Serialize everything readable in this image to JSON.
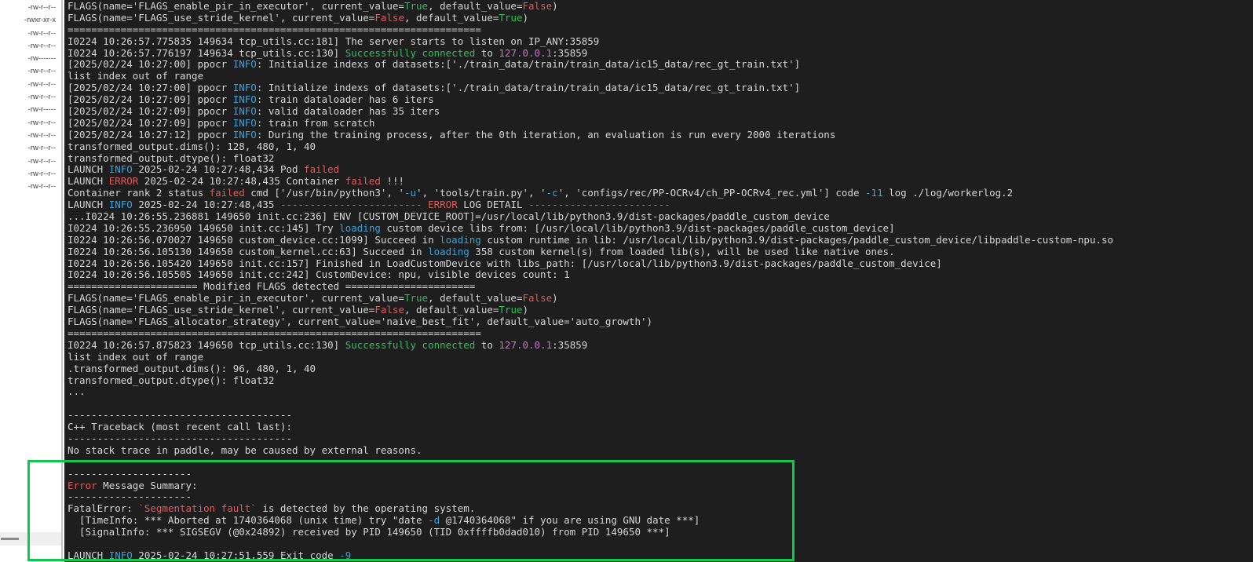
{
  "colors": {
    "terminal_bg": "#1e1e1e",
    "default": "#d6d6d6",
    "cyan": "#3ca1d8",
    "green": "#2cc05c",
    "red": "#df5b5b",
    "magenta": "#cf6ecf",
    "highlight_box": "#12c74e",
    "sidebar_bg": "#ffffff",
    "sidebar_text": "#3f3f3f"
  },
  "sidebar": {
    "permissions": [
      "-rw-r--r--",
      "-rwxr-xr-x",
      "-rw-r--r--",
      "-rw-r--r--",
      "-rw-------",
      "-rw-r--r--",
      "-rw-r--r--",
      "-rw-r--r--",
      "-rw-r-----",
      "-rw-r--r--",
      "-rw-r--r--",
      "-rw-r--r--",
      "-rw-r--r--",
      "-rw-r--r--",
      "-rw-r--r--"
    ]
  },
  "annotation": {
    "highlight_box_present": true
  },
  "terminal": {
    "lines": [
      {
        "segments": [
          {
            "text": "FLAGS(name='FLAGS_enable_pir_in_executor', current_value=",
            "color": "default"
          },
          {
            "text": "True",
            "color": "green"
          },
          {
            "text": ", default_value=",
            "color": "default"
          },
          {
            "text": "False",
            "color": "red"
          },
          {
            "text": ")",
            "color": "default"
          }
        ]
      },
      {
        "segments": [
          {
            "text": "FLAGS(name='FLAGS_use_stride_kernel', current_value=",
            "color": "default"
          },
          {
            "text": "False",
            "color": "red"
          },
          {
            "text": ", default_value=",
            "color": "default"
          },
          {
            "text": "True",
            "color": "green"
          },
          {
            "text": ")",
            "color": "default"
          }
        ]
      },
      {
        "segments": [
          {
            "text": "======================================================================",
            "color": "default"
          }
        ]
      },
      {
        "segments": [
          {
            "text": "I0224 10:26:57.775835 149634 tcp_utils.cc:181] The server starts to listen on IP_ANY:35859",
            "color": "default"
          }
        ]
      },
      {
        "segments": [
          {
            "text": "I0224 10:26:57.776197 149634 tcp_utils.cc:130] ",
            "color": "default"
          },
          {
            "text": "Successfully connected",
            "color": "green"
          },
          {
            "text": " to ",
            "color": "default"
          },
          {
            "text": "127.0.0.1",
            "color": "magenta"
          },
          {
            "text": ":35859",
            "color": "default"
          }
        ]
      },
      {
        "segments": [
          {
            "text": "[2025/02/24 10:27:00] ppocr ",
            "color": "default"
          },
          {
            "text": "INFO",
            "color": "cyan"
          },
          {
            "text": ": Initialize indexs of datasets:['./train_data/train/train_data/ic15_data/rec_gt_train.txt']",
            "color": "default"
          }
        ]
      },
      {
        "segments": [
          {
            "text": "list index out of range",
            "color": "default"
          }
        ]
      },
      {
        "segments": [
          {
            "text": "[2025/02/24 10:27:00] ppocr ",
            "color": "default"
          },
          {
            "text": "INFO",
            "color": "cyan"
          },
          {
            "text": ": Initialize indexs of datasets:['./train_data/train/train_data/ic15_data/rec_gt_train.txt']",
            "color": "default"
          }
        ]
      },
      {
        "segments": [
          {
            "text": "[2025/02/24 10:27:09] ppocr ",
            "color": "default"
          },
          {
            "text": "INFO",
            "color": "cyan"
          },
          {
            "text": ": train dataloader has 6 iters",
            "color": "default"
          }
        ]
      },
      {
        "segments": [
          {
            "text": "[2025/02/24 10:27:09] ppocr ",
            "color": "default"
          },
          {
            "text": "INFO",
            "color": "cyan"
          },
          {
            "text": ": valid dataloader has 35 iters",
            "color": "default"
          }
        ]
      },
      {
        "segments": [
          {
            "text": "[2025/02/24 10:27:09] ppocr ",
            "color": "default"
          },
          {
            "text": "INFO",
            "color": "cyan"
          },
          {
            "text": ": train from scratch",
            "color": "default"
          }
        ]
      },
      {
        "segments": [
          {
            "text": "[2025/02/24 10:27:12] ppocr ",
            "color": "default"
          },
          {
            "text": "INFO",
            "color": "cyan"
          },
          {
            "text": ": During the training process, after the 0th iteration, an evaluation is run every 2000 iterations",
            "color": "default"
          }
        ]
      },
      {
        "segments": [
          {
            "text": "transformed_output.dims(): 128, 480, 1, 40",
            "color": "default"
          }
        ]
      },
      {
        "segments": [
          {
            "text": "transformed_output.dtype(): float32",
            "color": "default"
          }
        ]
      },
      {
        "segments": [
          {
            "text": "LAUNCH ",
            "color": "default"
          },
          {
            "text": "INFO",
            "color": "cyan"
          },
          {
            "text": " 2025-02-24 10:27:48,434 Pod ",
            "color": "default"
          },
          {
            "text": "failed",
            "color": "red"
          }
        ]
      },
      {
        "segments": [
          {
            "text": "LAUNCH ",
            "color": "default"
          },
          {
            "text": "ERROR",
            "color": "red"
          },
          {
            "text": " 2025-02-24 10:27:48,435 Container ",
            "color": "default"
          },
          {
            "text": "failed",
            "color": "red"
          },
          {
            "text": " !!!",
            "color": "default"
          }
        ]
      },
      {
        "segments": [
          {
            "text": "Container rank 2 status ",
            "color": "default"
          },
          {
            "text": "failed",
            "color": "red"
          },
          {
            "text": " cmd ['/usr/bin/python3', '",
            "color": "default"
          },
          {
            "text": "-u",
            "color": "cyan"
          },
          {
            "text": "', 'tools/train.py', '",
            "color": "default"
          },
          {
            "text": "-c",
            "color": "cyan"
          },
          {
            "text": "', 'configs/rec/PP-OCRv4/ch_PP-OCRv4_rec.yml'] code ",
            "color": "default"
          },
          {
            "text": "-11",
            "color": "cyan"
          },
          {
            "text": " log ./log/workerlog.2",
            "color": "default"
          }
        ]
      },
      {
        "segments": [
          {
            "text": "LAUNCH ",
            "color": "default"
          },
          {
            "text": "INFO",
            "color": "cyan"
          },
          {
            "text": " 2025-02-24 10:27:48,435 ",
            "color": "default"
          },
          {
            "text": "------------------------ ",
            "color": "cyan"
          },
          {
            "text": "ERROR",
            "color": "red"
          },
          {
            "text": " LOG DETAIL ",
            "color": "default"
          },
          {
            "text": "------------------------",
            "color": "cyan"
          }
        ]
      },
      {
        "segments": [
          {
            "text": "...I0224 10:26:55.236881 149650 init.cc:236] ENV [CUSTOM_DEVICE_ROOT]=/usr/local/lib/python3.9/dist-packages/paddle_custom_device",
            "color": "default"
          }
        ]
      },
      {
        "segments": [
          {
            "text": "I0224 10:26:55.236950 149650 init.cc:145] Try ",
            "color": "default"
          },
          {
            "text": "loading",
            "color": "cyan"
          },
          {
            "text": " custom device libs from: [/usr/local/lib/python3.9/dist-packages/paddle_custom_device]",
            "color": "default"
          }
        ]
      },
      {
        "segments": [
          {
            "text": "I0224 10:26:56.070027 149650 custom_device.cc:1099] Succeed in ",
            "color": "default"
          },
          {
            "text": "loading",
            "color": "cyan"
          },
          {
            "text": " custom runtime in lib: /usr/local/lib/python3.9/dist-packages/paddle_custom_device/libpaddle-custom-npu.so",
            "color": "default"
          }
        ]
      },
      {
        "segments": [
          {
            "text": "I0224 10:26:56.105130 149650 custom_kernel.cc:63] Succeed in ",
            "color": "default"
          },
          {
            "text": "loading",
            "color": "cyan"
          },
          {
            "text": " 358 custom kernel(s) from loaded lib(s), will be used like native ones.",
            "color": "default"
          }
        ]
      },
      {
        "segments": [
          {
            "text": "I0224 10:26:56.105420 149650 init.cc:157] Finished in LoadCustomDevice with libs_path: [/usr/local/lib/python3.9/dist-packages/paddle_custom_device]",
            "color": "default"
          }
        ]
      },
      {
        "segments": [
          {
            "text": "I0224 10:26:56.105505 149650 init.cc:242] CustomDevice: npu, visible devices count: 1",
            "color": "default"
          }
        ]
      },
      {
        "segments": [
          {
            "text": "====================== Modified FLAGS detected ======================",
            "color": "default"
          }
        ]
      },
      {
        "segments": [
          {
            "text": "FLAGS(name='FLAGS_enable_pir_in_executor', current_value=",
            "color": "default"
          },
          {
            "text": "True",
            "color": "green"
          },
          {
            "text": ", default_value=",
            "color": "default"
          },
          {
            "text": "False",
            "color": "red"
          },
          {
            "text": ")",
            "color": "default"
          }
        ]
      },
      {
        "segments": [
          {
            "text": "FLAGS(name='FLAGS_use_stride_kernel', current_value=",
            "color": "default"
          },
          {
            "text": "False",
            "color": "red"
          },
          {
            "text": ", default_value=",
            "color": "default"
          },
          {
            "text": "True",
            "color": "green"
          },
          {
            "text": ")",
            "color": "default"
          }
        ]
      },
      {
        "segments": [
          {
            "text": "FLAGS(name='FLAGS_allocator_strategy', current_value='naive_best_fit', default_value='auto_growth')",
            "color": "default"
          }
        ]
      },
      {
        "segments": [
          {
            "text": "======================================================================",
            "color": "default"
          }
        ]
      },
      {
        "segments": [
          {
            "text": "I0224 10:26:57.875823 149650 tcp_utils.cc:130] ",
            "color": "default"
          },
          {
            "text": "Successfully connected",
            "color": "green"
          },
          {
            "text": " to ",
            "color": "default"
          },
          {
            "text": "127.0.0.1",
            "color": "magenta"
          },
          {
            "text": ":35859",
            "color": "default"
          }
        ]
      },
      {
        "segments": [
          {
            "text": "list index out of range",
            "color": "default"
          }
        ]
      },
      {
        "segments": [
          {
            "text": ".transformed_output.dims(): 96, 480, 1, 40",
            "color": "default"
          }
        ]
      },
      {
        "segments": [
          {
            "text": "transformed_output.dtype(): float32",
            "color": "default"
          }
        ]
      },
      {
        "segments": [
          {
            "text": "...",
            "color": "default"
          }
        ]
      },
      {
        "segments": []
      },
      {
        "segments": [
          {
            "text": "--------------------------------------",
            "color": "default"
          }
        ]
      },
      {
        "segments": [
          {
            "text": "C++ Traceback (most recent call last):",
            "color": "default"
          }
        ]
      },
      {
        "segments": [
          {
            "text": "--------------------------------------",
            "color": "default"
          }
        ]
      },
      {
        "segments": [
          {
            "text": "No stack trace in paddle, may be caused by external reasons.",
            "color": "default"
          }
        ]
      },
      {
        "segments": []
      },
      {
        "segments": [
          {
            "text": "---------------------",
            "color": "default"
          }
        ]
      },
      {
        "segments": [
          {
            "text": "Error",
            "color": "red"
          },
          {
            "text": " Message Summary:",
            "color": "default"
          }
        ]
      },
      {
        "segments": [
          {
            "text": "---------------------",
            "color": "default"
          }
        ]
      },
      {
        "segments": [
          {
            "text": "FatalError: ",
            "color": "default"
          },
          {
            "text": "`Segmentation fault`",
            "color": "red"
          },
          {
            "text": " is detected by the operating system.",
            "color": "default"
          }
        ]
      },
      {
        "segments": [
          {
            "text": "  [TimeInfo: *** Aborted at 1740364068 (unix time) try \"date ",
            "color": "default"
          },
          {
            "text": "-d",
            "color": "cyan"
          },
          {
            "text": " @1740364068\" if you are using GNU date ***]",
            "color": "default"
          }
        ]
      },
      {
        "segments": [
          {
            "text": "  [SignalInfo: *** SIGSEGV (@0x24892) received by PID 149650 (TID 0xffffb0dad010) from PID 149650 ***]",
            "color": "default"
          }
        ]
      },
      {
        "segments": []
      },
      {
        "segments": [
          {
            "text": "LAUNCH ",
            "color": "default"
          },
          {
            "text": "INFO",
            "color": "cyan"
          },
          {
            "text": " 2025-02-24 10:27:51,559 Exit code ",
            "color": "default"
          },
          {
            "text": "-9",
            "color": "cyan"
          }
        ]
      }
    ]
  }
}
